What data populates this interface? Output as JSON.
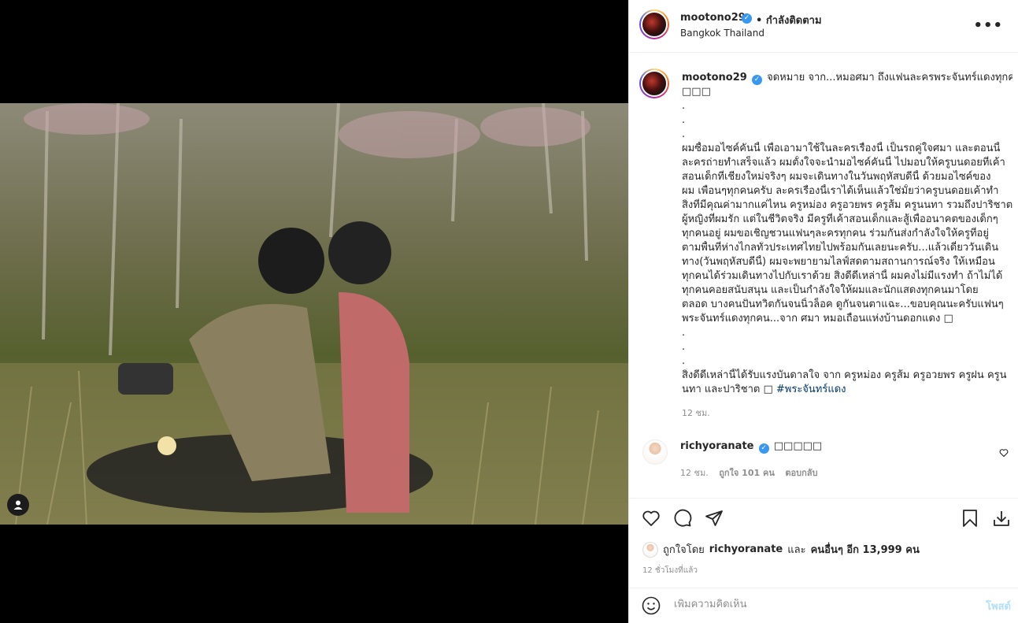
{
  "post": {
    "author": "mootono29",
    "follow_status": "• กำลังติดตาม",
    "location": "Bangkok Thailand",
    "more_icon": "more-horizontal-icon"
  },
  "caption": {
    "author": "mootono29",
    "lines": [
      "จดหมาย จาก...หมอศมา ถึงแฟนละครพระจันทร์แดงทุกคน",
      "□□□",
      ".",
      ".",
      ".",
      "ผมซื้อมอไซค์คันนี้ เพื่อเอามาใช้ในละครเรื่องนี้ เป็นรถคู่ใจศมา และตอนนี้",
      "ละครถ่ายทำเสร็จแล้ว ผมตั้งใจจะนำมอไซค์คันนี้ ไปมอบให้ครูบนดอยที่เค้า",
      "สอนเด็กที่เชียงใหม่จริงๆ ผมจะเดินทางในวันพฤหัสบดีนี้ ด้วยมอไซค์ของ",
      "ผม เพื่อนๆทุกคนครับ ละครเรื่องนี้เราได้เห็นแล้วใช่มั้ยว่าครูบนดอยเค้าทำ",
      "สิ่งที่มีคุณค่ามากแค่ไหน ครูหม่อง ครูอวยพร ครูส้ม ครูนนทา รวมถึงปาริชาต",
      "ผู้หญิงที่ผมรัก แต่ในชีวิตจริง มีครูที่เค้าสอนเด็กและสู้เพื่ออนาคตของเด็กๆ",
      "ทุกคนอยู่ ผมขอเชิญชวนแฟนๆละครทุกคน ร่วมกันส่งกำลังใจให้ครูที่อยู่",
      "ตามพื้นที่ห่างไกลทั่วประเทศไทยไปพร้อมกันเลยนะครับ...แล้วเดี๋ยววันเดิน",
      "ทาง(วันพฤหัสบดีนี้) ผมจะพยายามไลฟ์สดตามสถานการณ์จริง ให้เหมือน",
      "ทุกคนได้ร่วมเดินทางไปกับเราด้วย สิ่งดีดีเหล่านี้ ผมคงไม่มีแรงทำ ถ้าไม่ได้",
      "ทุกคนคอยสนับสนุน และเป็นกำลังใจให้ผมและนักแสดงทุกคนมาโดย",
      "ตลอด บางคนปั่นทวิตกันจนนิ้วล็อค ดูกันจนตาแฉะ...ขอบคุณนะครับแฟนๆ",
      "พระจันทร์แดงทุกคน...จาก ศมา หมอเถื่อนแห่งบ้านดอกแดง □",
      ".",
      ".",
      ".",
      "สิ่งดีดีเหล่านี้ได้รับแรงบันดาลใจ จาก ครูหม่อง ครูส้ม ครูอวยพร ครูฝน ครูน",
      "นทา และปาริชาต □"
    ],
    "hashtag": "#พระจันทร์แดง",
    "time": "12 ชม."
  },
  "comment": {
    "author": "richyoranate",
    "text": "□□□□□",
    "time": "12 ชม.",
    "likes": "ถูกใจ 101 คน",
    "reply": "ตอบกลับ"
  },
  "likes": {
    "prefix": "ถูกใจโดย",
    "user": "richyoranate",
    "joiner": "และ",
    "others": "คนอื่นๆ อีก 13,999 คน"
  },
  "time_ago": "12 ชั่วโมงที่แล้ว",
  "add_comment": {
    "placeholder": "เพิ่มความคิดเห็น",
    "post_label": "โพสต์"
  },
  "colors": {
    "verified": "#3897f0",
    "hashtag": "#00376b",
    "post_disabled": "#b2dffc"
  }
}
